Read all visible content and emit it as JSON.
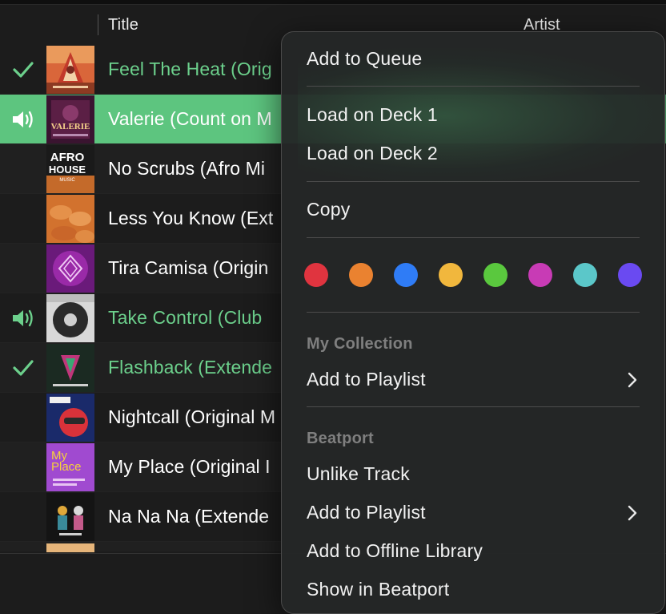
{
  "header": {
    "col_title": "Title",
    "col_artist": "Artist"
  },
  "tracks": [
    {
      "status": "check-icon",
      "title": "Feel The Heat (Orig",
      "state": "played",
      "title_color": "#6cd08c"
    },
    {
      "status": "speaker-icon",
      "title": "Valerie (Count on M",
      "state": "playing",
      "title_color": "#ffffff"
    },
    {
      "status": "",
      "title": "No Scrubs (Afro Mi",
      "state": "normal",
      "title_color": "#ffffff"
    },
    {
      "status": "",
      "title": "Less You Know (Ext",
      "state": "normal",
      "title_color": "#ffffff"
    },
    {
      "status": "",
      "title": "Tira Camisa (Origin",
      "state": "normal",
      "title_color": "#ffffff"
    },
    {
      "status": "speaker-icon",
      "title": "Take Control (Club",
      "state": "loaded",
      "title_color": "#6cd08c"
    },
    {
      "status": "check-icon",
      "title": "Flashback (Extende",
      "state": "played",
      "title_color": "#6cd08c"
    },
    {
      "status": "",
      "title": "Nightcall (Original M",
      "state": "normal",
      "title_color": "#ffffff"
    },
    {
      "status": "",
      "title": "My Place (Original I",
      "state": "normal",
      "title_color": "#ffffff"
    },
    {
      "status": "",
      "title": "Na Na Na (Extende",
      "state": "normal",
      "title_color": "#ffffff"
    }
  ],
  "artwork": {
    "valerie_text": "VALERIE",
    "afro_line1": "AFRO",
    "afro_line2": "HOUSE",
    "afro_line3": "MUSIC",
    "myplace_line1": "My",
    "myplace_line2": "Place"
  },
  "menu": {
    "add_to_queue": "Add to Queue",
    "load_deck_1": "Load on Deck 1",
    "load_deck_2": "Load on Deck 2",
    "copy": "Copy",
    "colors": [
      "#e0343f",
      "#ea8230",
      "#2f7cf6",
      "#f1b73d",
      "#5ac83e",
      "#c83bb5",
      "#5bc7c9",
      "#6a4af1"
    ],
    "section_my_collection": "My Collection",
    "add_to_playlist_collection": "Add to Playlist",
    "section_beatport": "Beatport",
    "unlike_track": "Unlike Track",
    "add_to_playlist_beatport": "Add to Playlist",
    "add_to_offline_library": "Add to Offline Library",
    "show_in_beatport": "Show in Beatport"
  },
  "theme": {
    "accent_green": "#5dc57f",
    "background": "#1c1c1c",
    "menu_background": "#262828"
  }
}
